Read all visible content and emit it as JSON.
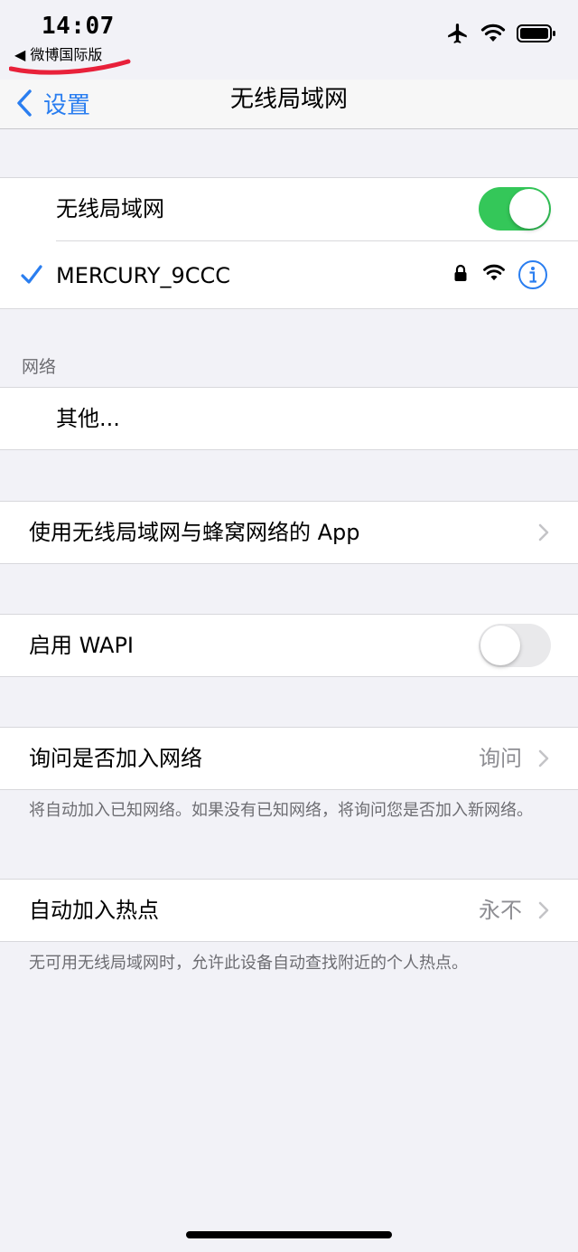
{
  "status_bar": {
    "time": "14:07",
    "back_app": "◀ 微博国际版"
  },
  "nav": {
    "back_label": "设置",
    "title": "无线局域网"
  },
  "wifi": {
    "toggle_label": "无线局域网",
    "toggle_on": true,
    "connected_network": "MERCURY_9CCC"
  },
  "networks": {
    "header": "网络",
    "other_label": "其他..."
  },
  "apps_row": {
    "label": "使用无线局域网与蜂窝网络的 App"
  },
  "wapi": {
    "label": "启用 WAPI",
    "toggle_on": false
  },
  "ask_join": {
    "label": "询问是否加入网络",
    "value": "询问",
    "footer": "将自动加入已知网络。如果没有已知网络，将询问您是否加入新网络。"
  },
  "hotspot": {
    "label": "自动加入热点",
    "value": "永不",
    "footer": "无可用无线局域网时，允许此设备自动查找附近的个人热点。"
  },
  "colors": {
    "accent": "#2a7ef0",
    "toggle_on": "#34c759",
    "annotation": "#e8203a"
  }
}
